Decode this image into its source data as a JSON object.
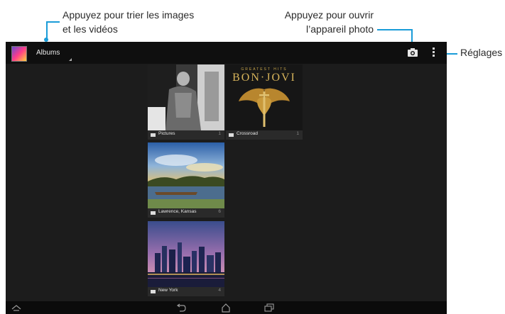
{
  "annotations": {
    "sort": [
      "Appuyez pour trier les images",
      "et les vidéos"
    ],
    "camera": [
      "Appuyez pour ouvrir",
      "l’appareil photo"
    ],
    "settings": "Réglages"
  },
  "actionbar": {
    "title": "Albums"
  },
  "albums": [
    {
      "name": "Pictures",
      "count": "1"
    },
    {
      "name": "Crossroad",
      "count": "1"
    },
    {
      "name": "Lawrence, Kansas",
      "count": "6"
    },
    {
      "name": "New York",
      "count": "4"
    }
  ],
  "album_art": {
    "line1": "GREATEST HITS",
    "line2": "BON·JOVI"
  },
  "colors": {
    "callout": "#1a9cd8",
    "screen_bg": "#1c1c1c",
    "actionbar_bg": "#0f0f0f"
  },
  "icons": [
    "gallery-app-icon",
    "camera-icon",
    "overflow-menu-icon",
    "folder-icon",
    "home-icon",
    "back-icon",
    "recent-apps-icon"
  ]
}
